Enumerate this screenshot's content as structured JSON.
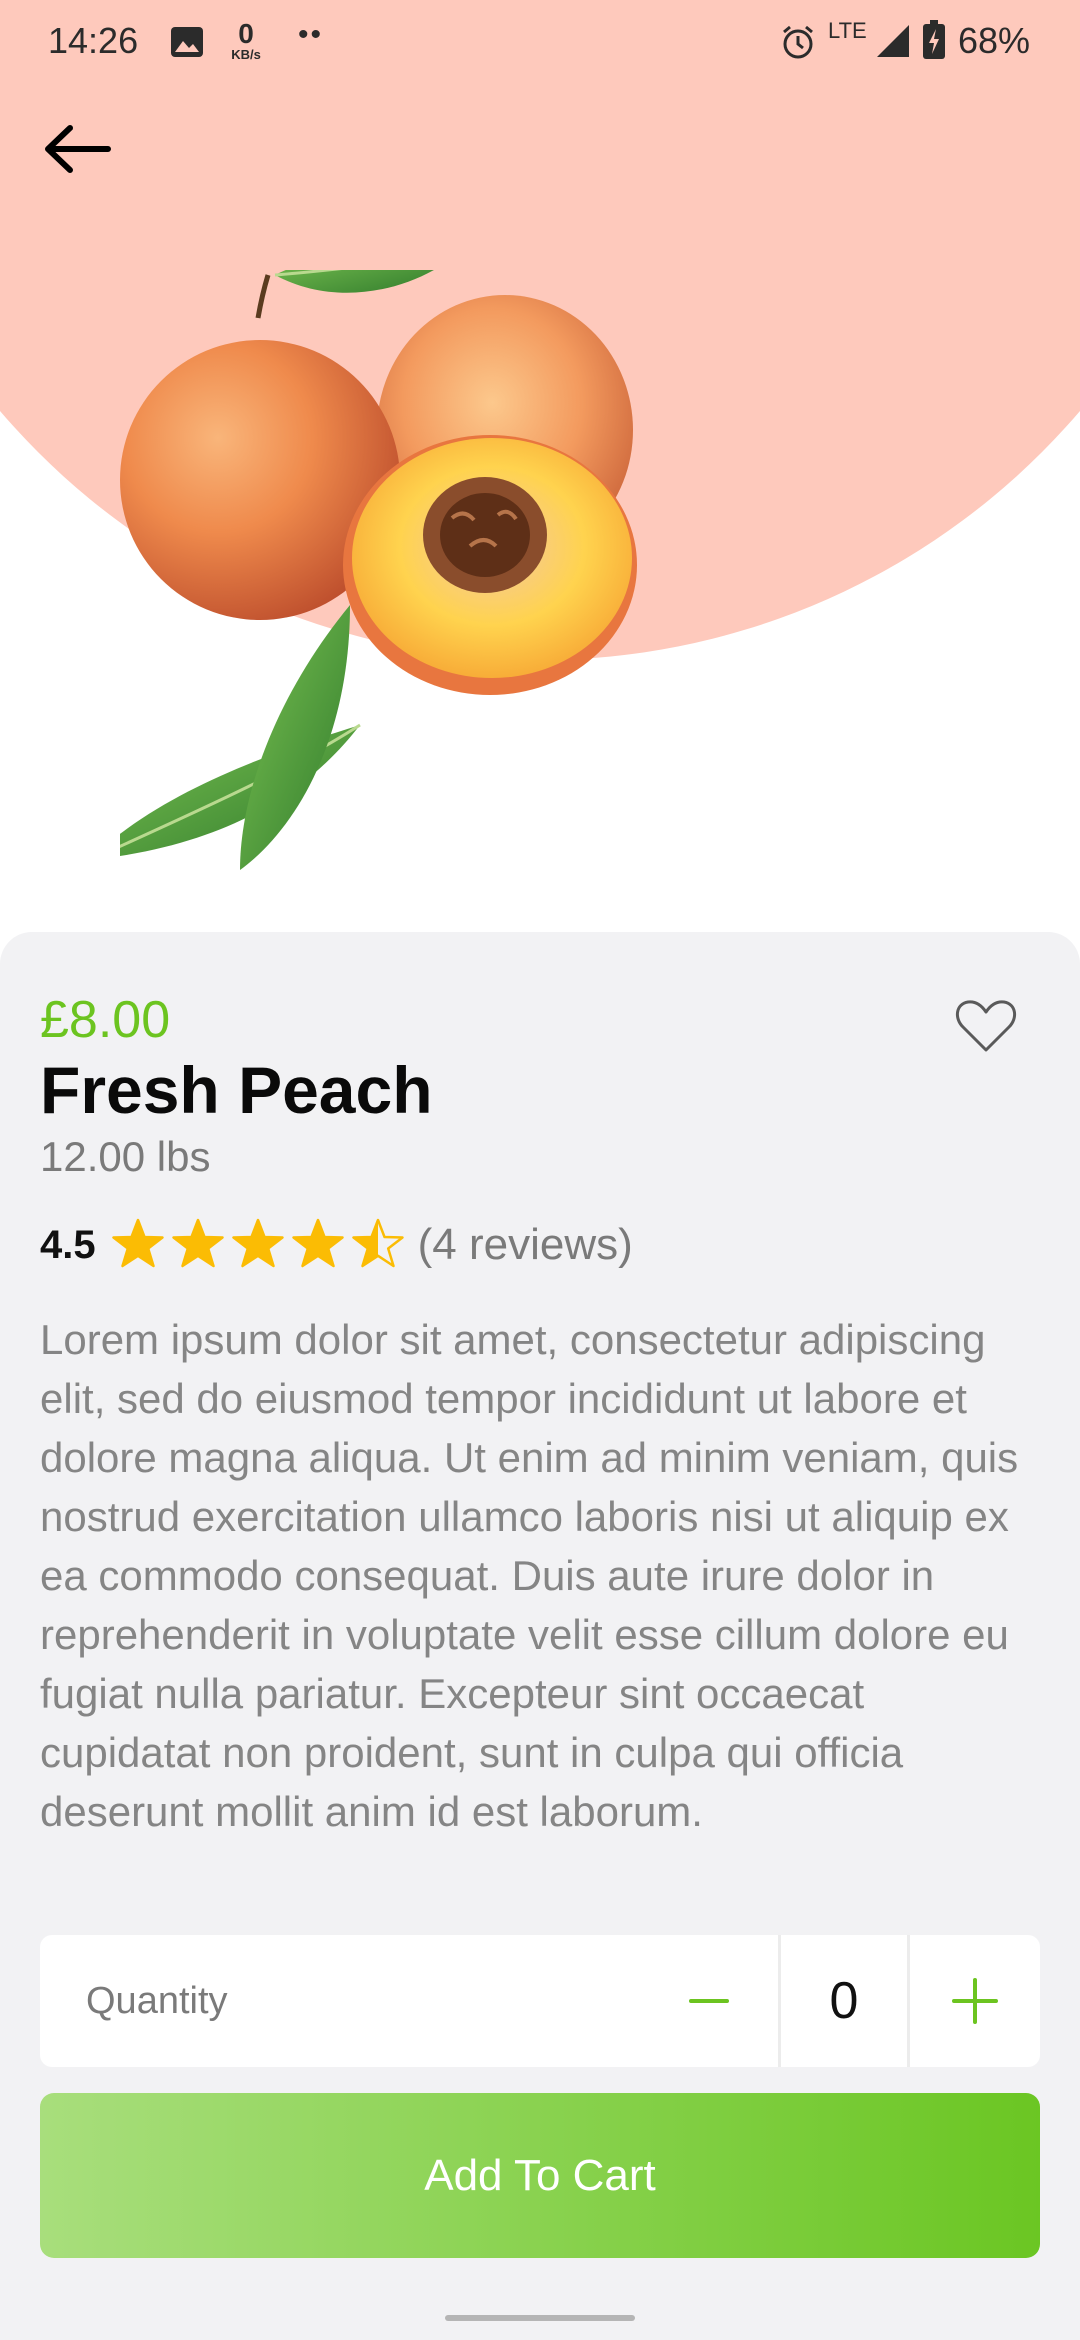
{
  "status_bar": {
    "time": "14:26",
    "net_speed_value": "0",
    "net_speed_unit": "KB/s",
    "network_type": "LTE",
    "battery_percent": "68%",
    "icons": [
      "image-icon",
      "more-dots-icon",
      "alarm-icon",
      "signal-icon",
      "battery-charging-icon"
    ]
  },
  "header": {
    "back_icon": "arrow-left-icon"
  },
  "product": {
    "price": "£8.00",
    "name": "Fresh Peach",
    "weight": "12.00 lbs",
    "rating_value": "4.5",
    "rating_stars": 4.5,
    "rating_max": 5,
    "reviews_text": "(4 reviews)",
    "favorite_icon": "heart-outline-icon",
    "description": "Lorem ipsum dolor sit amet, consectetur adipiscing elit, sed do eiusmod tempor incididunt ut labore et dolore magna aliqua. Ut enim ad minim veniam, quis nostrud exercitation ullamco laboris nisi ut aliquip ex ea commodo consequat. Duis aute irure dolor in reprehenderit in voluptate velit esse cillum dolore eu fugiat nulla pariatur. Excepteur sint occaecat cupidatat non proident, sunt in culpa qui officia deserunt mollit anim id est laborum."
  },
  "quantity": {
    "label": "Quantity",
    "value": "0"
  },
  "actions": {
    "add_to_cart": "Add To Cart"
  },
  "colors": {
    "accent_green": "#6cc420",
    "hero_background": "#fec9bc",
    "star": "#fbbc04",
    "card_background": "#f2f2f4"
  }
}
